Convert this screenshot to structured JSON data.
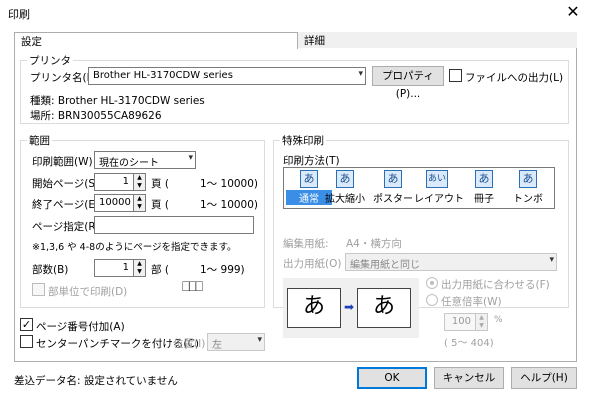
{
  "window": {
    "title": "印刷",
    "close_icon": "close-icon"
  },
  "tabs": [
    {
      "label": "設定",
      "active": true
    },
    {
      "label": "詳細",
      "active": false
    }
  ],
  "printer": {
    "group_label": "プリンタ",
    "name_label": "プリンタ名(N)",
    "name_value": "Brother HL-3170CDW series",
    "properties_button": "プロパティ(P)...",
    "print_to_file_label": "ファイルへの出力(L)",
    "type_line": "種類: Brother HL-3170CDW series",
    "location_line": "場所: BRN30055CA89626"
  },
  "range": {
    "group_label": "範囲",
    "print_range_label": "印刷範囲(W)",
    "print_range_value": "現在のシート",
    "start_page_label": "開始ページ(S)",
    "start_page_value": "1",
    "start_page_unit": "頁 (",
    "start_page_range": "1〜 10000)",
    "end_page_label": "終了ページ(E)",
    "end_page_value": "10000",
    "end_page_unit": "頁 (",
    "end_page_range": "1〜 10000)",
    "page_spec_label": "ページ指定(R)",
    "page_spec_value": "",
    "page_spec_note": "※1,3,6 や 4-8のようにページを指定できます。",
    "copies_label": "部数(B)",
    "copies_value": "1",
    "copies_unit": "部 (",
    "copies_range": "1〜     999)",
    "collate_label": "部単位で印刷(D)"
  },
  "special": {
    "group_label": "特殊印刷",
    "method_group_label": "印刷方法(T)",
    "methods": [
      {
        "label": "通常",
        "icon": "あ",
        "selected": true
      },
      {
        "label": "拡大縮小",
        "icon": "あ",
        "selected": false
      },
      {
        "label": "ポスター",
        "icon": "あ",
        "selected": false
      },
      {
        "label": "レイアウト",
        "icon": "あい",
        "selected": false
      },
      {
        "label": "冊子",
        "icon": "あ",
        "selected": false
      },
      {
        "label": "トンボ",
        "icon": "あ",
        "selected": false
      }
    ],
    "edit_paper_label": "編集用紙:",
    "edit_paper_value": "A4・横方向",
    "output_paper_label": "出力用紙(O)",
    "output_paper_value": "編集用紙と同じ",
    "fit_paper_label": "出力用紙に合わせる(F)",
    "custom_scale_label": "任意倍率(W)",
    "scale_value": "100",
    "scale_unit": "%",
    "scale_range": "(     5〜 404)",
    "preview_char": "あ"
  },
  "options": {
    "page_number_label": "ページ番号付加(A)",
    "page_number_checked": true,
    "punch_mark_label": "センターパンチマークを付ける(C)",
    "punch_mark_checked": false,
    "position_label": "位置(I)",
    "position_value": "左"
  },
  "footer": {
    "merge_label": "差込データ名:",
    "merge_value": "設定されていません",
    "ok_button": "OK",
    "cancel_button": "キャンセル",
    "help_button": "ヘルプ(H)"
  },
  "colors": {
    "accent": "#0078d7",
    "selection": "#3a8ee6"
  }
}
